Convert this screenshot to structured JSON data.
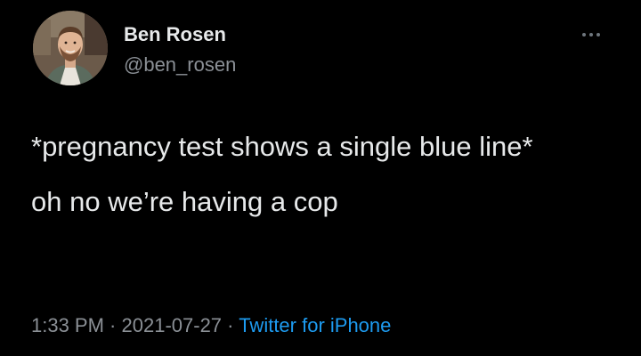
{
  "tweet": {
    "display_name": "Ben Rosen",
    "handle": "@ben_rosen",
    "line1": "*pregnancy test shows a single blue line*",
    "line2": "oh no we’re having a cop",
    "time": "1:33 PM",
    "separator": " · ",
    "date": "2021-07-27",
    "source": "Twitter for iPhone"
  },
  "icons": {
    "more": "more-horizontal-icon",
    "avatar": "avatar"
  },
  "colors": {
    "background": "#000000",
    "text": "#e7e9ea",
    "secondary_text": "#8b9096",
    "link": "#1d9bf0"
  }
}
